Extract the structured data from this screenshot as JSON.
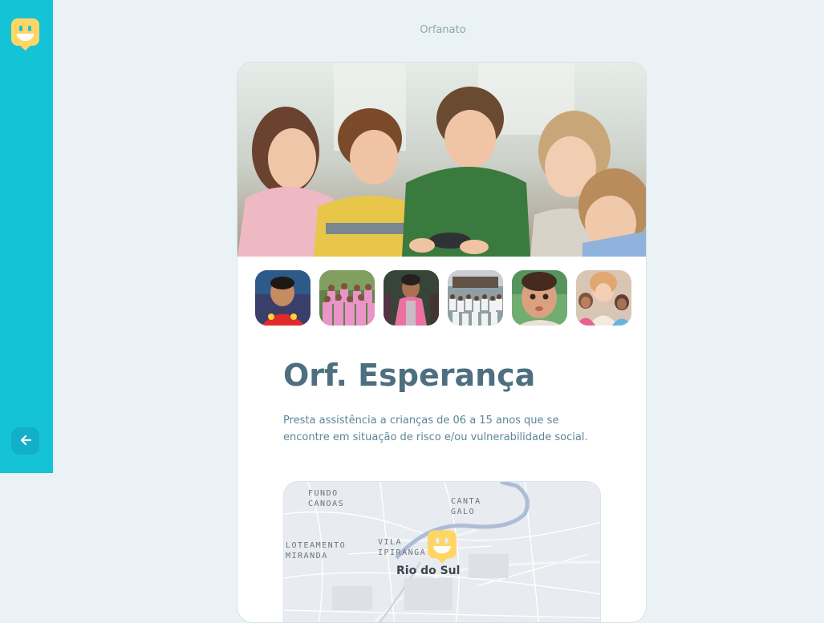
{
  "app": {
    "page_title": "Orfanato"
  },
  "sidebar": {
    "logo_icon": "smiley-pin-icon",
    "back_icon": "arrow-left-icon",
    "brand_color": "#15c3d6",
    "logo_color": "#ffd666"
  },
  "orphanage": {
    "name": "Orf. Esperança",
    "about": "Presta assistência a crianças de 06 a 15 anos que se encontre em situação de risco e/ou vulnerabilidade social.",
    "hero_image": "children-examining-object-photo",
    "gallery": [
      {
        "image": "boy-red-shirt-photo",
        "active": true
      },
      {
        "image": "group-pink-uniforms-photo",
        "active": false
      },
      {
        "image": "girl-pink-vest-photo",
        "active": false
      },
      {
        "image": "school-group-photo",
        "active": false
      },
      {
        "image": "toddler-face-photo",
        "active": false
      },
      {
        "image": "woman-with-children-photo",
        "active": false
      }
    ]
  },
  "map": {
    "labels": [
      {
        "text": "FUNDO\nCANOAS"
      },
      {
        "text": "CANTA\nGALO"
      },
      {
        "text": "LOTEAMENTO\nMIRANDA"
      },
      {
        "text": "VILA\nIPIRANGA"
      }
    ],
    "city": "Rio do Sul",
    "marker_icon": "smiley-pin-icon"
  }
}
